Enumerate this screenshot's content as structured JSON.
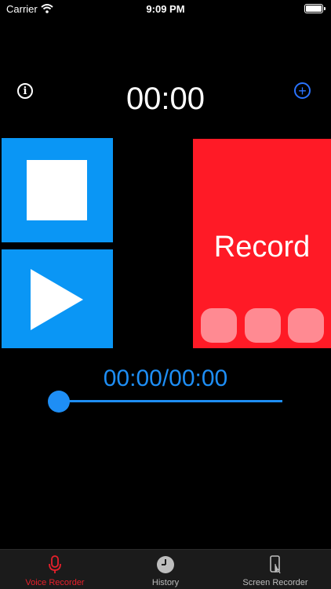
{
  "status_bar": {
    "carrier": "Carrier",
    "time": "9:09 PM"
  },
  "header": {
    "timer": "00:00",
    "info_icon": "info-icon",
    "add_icon": "plus-circle-icon"
  },
  "controls": {
    "stop_icon": "stop-icon",
    "play_icon": "play-icon",
    "record_label": "Record"
  },
  "playback": {
    "time": "00:00/00:00",
    "position": 0
  },
  "tabs": [
    {
      "label": "Voice Recorder",
      "icon": "microphone-icon",
      "active": true
    },
    {
      "label": "History",
      "icon": "clock-icon",
      "active": false
    },
    {
      "label": "Screen Recorder",
      "icon": "phone-tap-icon",
      "active": false
    }
  ],
  "colors": {
    "accent_blue": "#0a96f5",
    "record_red": "#ff1a26",
    "active_tab": "#e8202b"
  }
}
